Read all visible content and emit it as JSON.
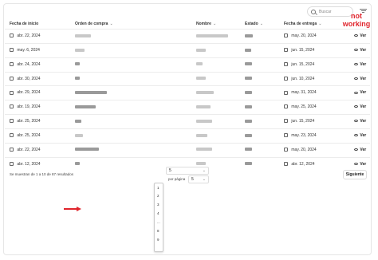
{
  "search": {
    "placeholder": "Buscar"
  },
  "annotation": {
    "text_line1": "not",
    "text_line2": "working"
  },
  "table": {
    "columns": [
      "Fecha de inicio",
      "Orden de compra",
      "Nombre",
      "Estado",
      "Fecha de entrega"
    ],
    "action_label": "Ver",
    "rows": [
      {
        "start": "abr. 22, 2024",
        "delivery": "may. 20, 2024"
      },
      {
        "start": "may. 6, 2024",
        "delivery": "jun. 15, 2024"
      },
      {
        "start": "abr. 24, 2024",
        "delivery": "jun. 15, 2024"
      },
      {
        "start": "abr. 30, 2024",
        "delivery": "jun. 10, 2024"
      },
      {
        "start": "abr. 29, 2024",
        "delivery": "may. 31, 2024"
      },
      {
        "start": "abr. 19, 2024",
        "delivery": "may. 25, 2024"
      },
      {
        "start": "abr. 25, 2024",
        "delivery": "jun. 15, 2024"
      },
      {
        "start": "abr. 25, 2024",
        "delivery": "may. 23, 2024"
      },
      {
        "start": "abr. 22, 2024",
        "delivery": "may. 20, 2024"
      },
      {
        "start": "abr. 12, 2024",
        "delivery": "abr. 12, 2024"
      }
    ]
  },
  "pagination": {
    "summary": "Se muestran de 1 a 10 de 87 resultados",
    "page_value": "5",
    "per_page_label": "por página",
    "per_page_value": "5",
    "next_label": "Siguiente",
    "dropdown_items": [
      "1",
      "2",
      "3",
      "4",
      "...",
      "8",
      "9"
    ]
  },
  "colors": {
    "annotation": "#e0242c"
  }
}
